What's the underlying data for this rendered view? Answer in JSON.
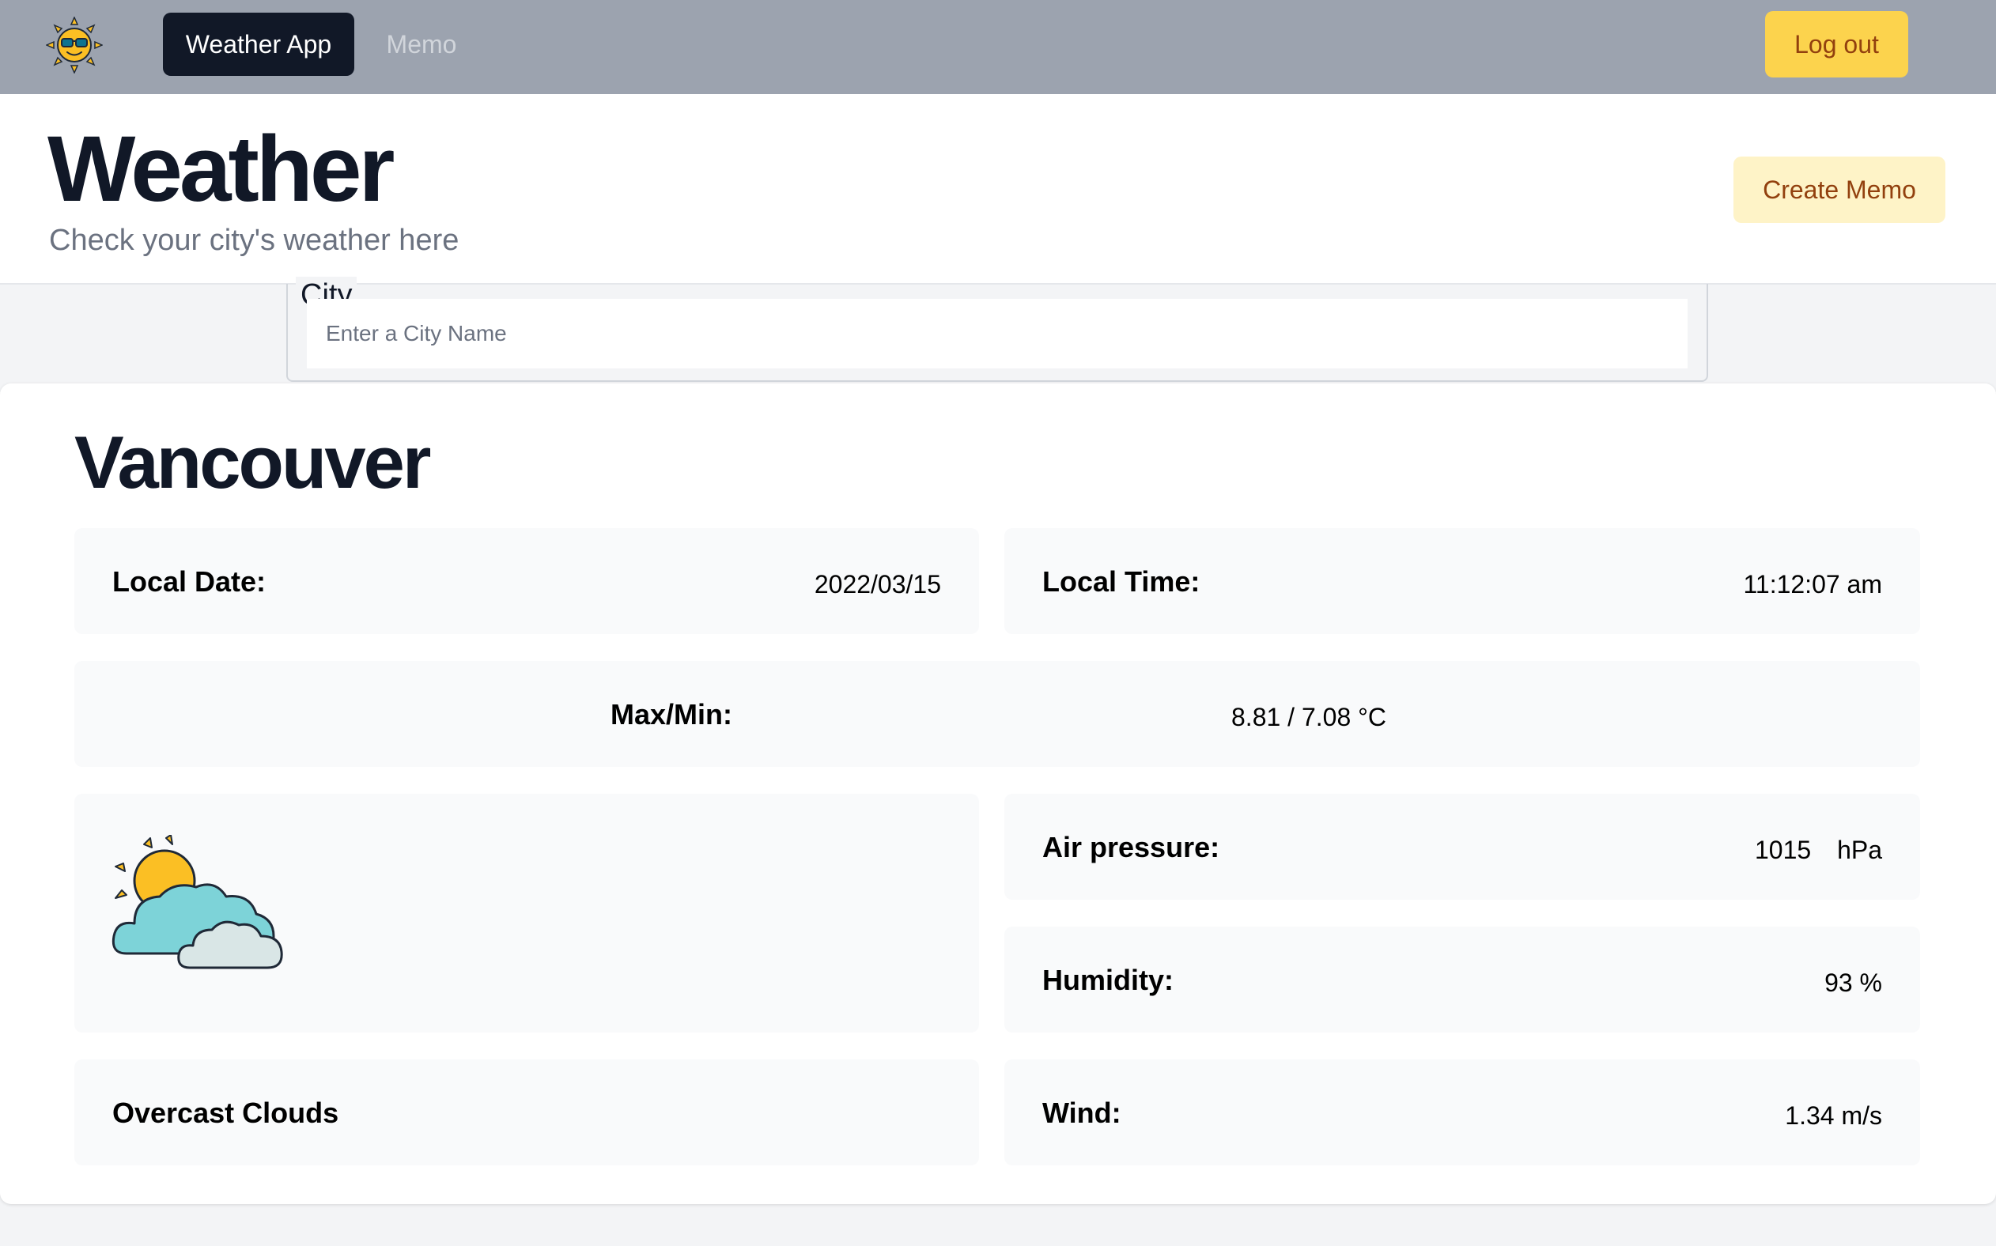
{
  "nav": {
    "logo_icon": "sun-with-sunglasses-icon",
    "active_tab": "Weather App",
    "memo_tab": "Memo",
    "logout_label": "Log out"
  },
  "header": {
    "title": "Weather",
    "subtitle": "Check your city's weather here",
    "create_memo_label": "Create Memo"
  },
  "search": {
    "label": "City",
    "placeholder": "Enter a City Name",
    "value": ""
  },
  "weather": {
    "city": "Vancouver",
    "local_date_label": "Local Date:",
    "local_date": "2022/03/15",
    "local_time_label": "Local Time:",
    "local_time": "11:12:07 am",
    "maxmin_label": "Max/Min:",
    "maxmin": "8.81 / 7.08 °C",
    "icon": "partly-cloudy-icon",
    "pressure_label": "Air pressure:",
    "pressure": "1015",
    "pressure_unit": "hPa",
    "humidity_label": "Humidity:",
    "humidity": "93 %",
    "description": "Overcast Clouds",
    "wind_label": "Wind:",
    "wind": "1.34 m/s"
  },
  "colors": {
    "nav_bg": "#9ca3af",
    "accent_yellow": "#fcd34d",
    "dark": "#111827",
    "tile_bg": "#f9fafb"
  }
}
